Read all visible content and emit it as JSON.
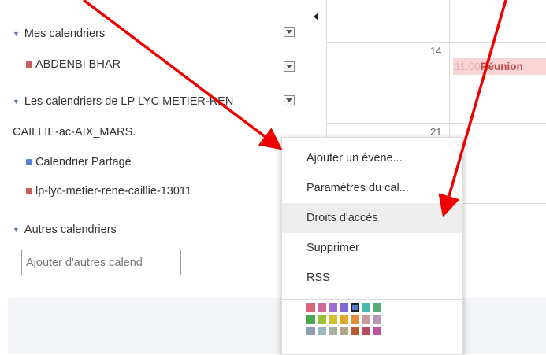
{
  "sidebar": {
    "my_calendars": {
      "label": "Mes calendriers",
      "items": [
        {
          "label": "ABDENBI BHAR",
          "color": "#cc5e62"
        }
      ]
    },
    "shared_calendars": {
      "label_line1": "Les calendriers de LP LYC METIER-REN",
      "label_line2": "CAILLIE-ac-AIX_MARS.",
      "items": [
        {
          "label": "Calendrier Partagé",
          "color": "#5b7fd4"
        },
        {
          "label": "lp-lyc-metier-rene-caillie-13011",
          "color": "#cc5e62"
        }
      ]
    },
    "other_calendars": {
      "label": "Autres calendriers",
      "input_placeholder": "Ajouter d'autres calend"
    }
  },
  "calendar": {
    "days": [
      "14",
      "21"
    ],
    "event": {
      "time": "11:00",
      "title": "Réunion"
    }
  },
  "context_menu": {
    "items": [
      "Ajouter un événe...",
      "Paramètres du cal...",
      "Droits d'accès",
      "Supprimer",
      "RSS"
    ],
    "selected": "Droits d'accès",
    "palette": [
      [
        "#d9657a",
        "#d2699b",
        "#9b6fcf",
        "#7e6bd6",
        "#5579c9",
        "#4cb8b3",
        "#5cab7d"
      ],
      [
        "#4aa84f",
        "#97c23c",
        "#d3c12d",
        "#e0a92c",
        "#e58b3e",
        "#c79a9a",
        "#b49ab6"
      ],
      [
        "#8f9db1",
        "#9bb5c2",
        "#a6b2a0",
        "#b5a68a",
        "#b95a32",
        "#b64a63",
        "#c0539e"
      ]
    ],
    "palette_selected": "#5579c9"
  },
  "annotations": {
    "arrow_color": "#ee0000"
  }
}
